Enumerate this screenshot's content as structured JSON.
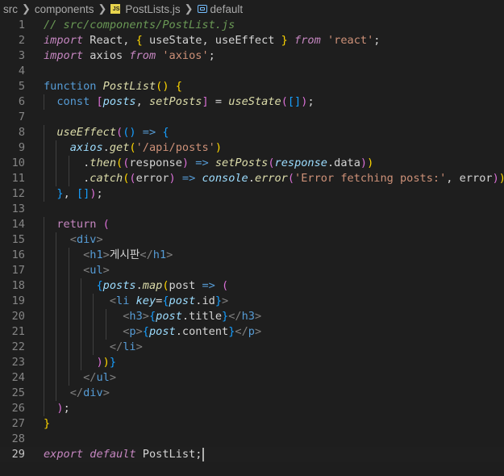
{
  "breadcrumb": {
    "folder1": "src",
    "folder2": "components",
    "file": "PostLists.js",
    "file_icon": "JS",
    "symbol": "default"
  },
  "editor": {
    "current_line": 29,
    "lines": [
      {
        "n": "1",
        "t": [
          {
            "c": "cm",
            "s": "// src/components/PostList.js"
          }
        ]
      },
      {
        "n": "2",
        "t": [
          {
            "c": "kw",
            "s": "import"
          },
          {
            "c": "tx",
            "s": " React, "
          },
          {
            "c": "br1",
            "s": "{"
          },
          {
            "c": "tx",
            "s": " useState, useEffect "
          },
          {
            "c": "br1",
            "s": "}"
          },
          {
            "c": "tx",
            "s": " "
          },
          {
            "c": "kw",
            "s": "from"
          },
          {
            "c": "tx",
            "s": " "
          },
          {
            "c": "st",
            "s": "'react'"
          },
          {
            "c": "tx",
            "s": ";"
          }
        ]
      },
      {
        "n": "3",
        "t": [
          {
            "c": "kw",
            "s": "import"
          },
          {
            "c": "tx",
            "s": " axios "
          },
          {
            "c": "kw",
            "s": "from"
          },
          {
            "c": "tx",
            "s": " "
          },
          {
            "c": "st",
            "s": "'axios'"
          },
          {
            "c": "tx",
            "s": ";"
          }
        ]
      },
      {
        "n": "4",
        "t": []
      },
      {
        "n": "5",
        "t": [
          {
            "c": "kwb",
            "s": "function"
          },
          {
            "c": "tx",
            "s": " "
          },
          {
            "c": "fn",
            "s": "PostList"
          },
          {
            "c": "br1",
            "s": "()"
          },
          {
            "c": "tx",
            "s": " "
          },
          {
            "c": "br1",
            "s": "{"
          }
        ]
      },
      {
        "n": "6",
        "t": [
          {
            "c": "tx",
            "s": "  "
          },
          {
            "c": "kwb",
            "s": "const"
          },
          {
            "c": "tx",
            "s": " "
          },
          {
            "c": "br2",
            "s": "["
          },
          {
            "c": "vr",
            "s": "posts"
          },
          {
            "c": "tx",
            "s": ", "
          },
          {
            "c": "fn",
            "s": "setPosts"
          },
          {
            "c": "br2",
            "s": "]"
          },
          {
            "c": "tx",
            "s": " = "
          },
          {
            "c": "fn",
            "s": "useState"
          },
          {
            "c": "br2",
            "s": "("
          },
          {
            "c": "br3",
            "s": "[]"
          },
          {
            "c": "br2",
            "s": ")"
          },
          {
            "c": "tx",
            "s": ";"
          }
        ]
      },
      {
        "n": "7",
        "t": []
      },
      {
        "n": "8",
        "t": [
          {
            "c": "tx",
            "s": "  "
          },
          {
            "c": "fn",
            "s": "useEffect"
          },
          {
            "c": "br2",
            "s": "("
          },
          {
            "c": "br3",
            "s": "()"
          },
          {
            "c": "tx",
            "s": " "
          },
          {
            "c": "kwb",
            "s": "=>"
          },
          {
            "c": "tx",
            "s": " "
          },
          {
            "c": "br3",
            "s": "{"
          }
        ]
      },
      {
        "n": "9",
        "t": [
          {
            "c": "tx",
            "s": "    "
          },
          {
            "c": "vr",
            "s": "axios"
          },
          {
            "c": "tx",
            "s": "."
          },
          {
            "c": "fn",
            "s": "get"
          },
          {
            "c": "br1",
            "s": "("
          },
          {
            "c": "st",
            "s": "'/api/posts'"
          },
          {
            "c": "br1",
            "s": ")"
          }
        ]
      },
      {
        "n": "10",
        "t": [
          {
            "c": "tx",
            "s": "      ."
          },
          {
            "c": "fn",
            "s": "then"
          },
          {
            "c": "br1",
            "s": "("
          },
          {
            "c": "br2",
            "s": "("
          },
          {
            "c": "tx",
            "s": "response"
          },
          {
            "c": "br2",
            "s": ")"
          },
          {
            "c": "tx",
            "s": " "
          },
          {
            "c": "kwb",
            "s": "=>"
          },
          {
            "c": "tx",
            "s": " "
          },
          {
            "c": "fn",
            "s": "setPosts"
          },
          {
            "c": "br2",
            "s": "("
          },
          {
            "c": "vr",
            "s": "response"
          },
          {
            "c": "tx",
            "s": ".data"
          },
          {
            "c": "br2",
            "s": ")"
          },
          {
            "c": "br1",
            "s": ")"
          }
        ]
      },
      {
        "n": "11",
        "t": [
          {
            "c": "tx",
            "s": "      ."
          },
          {
            "c": "fn",
            "s": "catch"
          },
          {
            "c": "br1",
            "s": "("
          },
          {
            "c": "br2",
            "s": "("
          },
          {
            "c": "tx",
            "s": "error"
          },
          {
            "c": "br2",
            "s": ")"
          },
          {
            "c": "tx",
            "s": " "
          },
          {
            "c": "kwb",
            "s": "=>"
          },
          {
            "c": "tx",
            "s": " "
          },
          {
            "c": "vr",
            "s": "console"
          },
          {
            "c": "tx",
            "s": "."
          },
          {
            "c": "fn",
            "s": "error"
          },
          {
            "c": "br2",
            "s": "("
          },
          {
            "c": "st",
            "s": "'Error fetching posts:'"
          },
          {
            "c": "tx",
            "s": ", error"
          },
          {
            "c": "br2",
            "s": ")"
          },
          {
            "c": "br1",
            "s": ")"
          },
          {
            "c": "tx",
            "s": ";"
          }
        ]
      },
      {
        "n": "12",
        "t": [
          {
            "c": "tx",
            "s": "  "
          },
          {
            "c": "br3",
            "s": "}"
          },
          {
            "c": "tx",
            "s": ", "
          },
          {
            "c": "br3",
            "s": "[]"
          },
          {
            "c": "br2",
            "s": ")"
          },
          {
            "c": "tx",
            "s": ";"
          }
        ]
      },
      {
        "n": "13",
        "t": []
      },
      {
        "n": "14",
        "t": [
          {
            "c": "tx",
            "s": "  "
          },
          {
            "c": "ctrl",
            "s": "return"
          },
          {
            "c": "tx",
            "s": " "
          },
          {
            "c": "br2",
            "s": "("
          }
        ]
      },
      {
        "n": "15",
        "t": [
          {
            "c": "tx",
            "s": "    "
          },
          {
            "c": "tg",
            "s": "<"
          },
          {
            "c": "tn",
            "s": "div"
          },
          {
            "c": "tg",
            "s": ">"
          }
        ]
      },
      {
        "n": "16",
        "t": [
          {
            "c": "tx",
            "s": "      "
          },
          {
            "c": "tg",
            "s": "<"
          },
          {
            "c": "tn",
            "s": "h1"
          },
          {
            "c": "tg",
            "s": ">"
          },
          {
            "c": "tx",
            "s": "게시판"
          },
          {
            "c": "tg",
            "s": "</"
          },
          {
            "c": "tn",
            "s": "h1"
          },
          {
            "c": "tg",
            "s": ">"
          }
        ]
      },
      {
        "n": "17",
        "t": [
          {
            "c": "tx",
            "s": "      "
          },
          {
            "c": "tg",
            "s": "<"
          },
          {
            "c": "tn",
            "s": "ul"
          },
          {
            "c": "tg",
            "s": ">"
          }
        ]
      },
      {
        "n": "18",
        "t": [
          {
            "c": "tx",
            "s": "        "
          },
          {
            "c": "br3",
            "s": "{"
          },
          {
            "c": "vr",
            "s": "posts"
          },
          {
            "c": "tx",
            "s": "."
          },
          {
            "c": "fn",
            "s": "map"
          },
          {
            "c": "br1",
            "s": "("
          },
          {
            "c": "tx",
            "s": "post "
          },
          {
            "c": "kwb",
            "s": "=>"
          },
          {
            "c": "tx",
            "s": " "
          },
          {
            "c": "br2",
            "s": "("
          }
        ]
      },
      {
        "n": "19",
        "t": [
          {
            "c": "tx",
            "s": "          "
          },
          {
            "c": "tg",
            "s": "<"
          },
          {
            "c": "tn",
            "s": "li"
          },
          {
            "c": "tx",
            "s": " "
          },
          {
            "c": "at",
            "s": "key"
          },
          {
            "c": "tx",
            "s": "="
          },
          {
            "c": "br3",
            "s": "{"
          },
          {
            "c": "vr",
            "s": "post"
          },
          {
            "c": "tx",
            "s": ".id"
          },
          {
            "c": "br3",
            "s": "}"
          },
          {
            "c": "tg",
            "s": ">"
          }
        ]
      },
      {
        "n": "20",
        "t": [
          {
            "c": "tx",
            "s": "            "
          },
          {
            "c": "tg",
            "s": "<"
          },
          {
            "c": "tn",
            "s": "h3"
          },
          {
            "c": "tg",
            "s": ">"
          },
          {
            "c": "br3",
            "s": "{"
          },
          {
            "c": "vr",
            "s": "post"
          },
          {
            "c": "tx",
            "s": ".title"
          },
          {
            "c": "br3",
            "s": "}"
          },
          {
            "c": "tg",
            "s": "</"
          },
          {
            "c": "tn",
            "s": "h3"
          },
          {
            "c": "tg",
            "s": ">"
          }
        ]
      },
      {
        "n": "21",
        "t": [
          {
            "c": "tx",
            "s": "            "
          },
          {
            "c": "tg",
            "s": "<"
          },
          {
            "c": "tn",
            "s": "p"
          },
          {
            "c": "tg",
            "s": ">"
          },
          {
            "c": "br3",
            "s": "{"
          },
          {
            "c": "vr",
            "s": "post"
          },
          {
            "c": "tx",
            "s": ".content"
          },
          {
            "c": "br3",
            "s": "}"
          },
          {
            "c": "tg",
            "s": "</"
          },
          {
            "c": "tn",
            "s": "p"
          },
          {
            "c": "tg",
            "s": ">"
          }
        ]
      },
      {
        "n": "22",
        "t": [
          {
            "c": "tx",
            "s": "          "
          },
          {
            "c": "tg",
            "s": "</"
          },
          {
            "c": "tn",
            "s": "li"
          },
          {
            "c": "tg",
            "s": ">"
          }
        ]
      },
      {
        "n": "23",
        "t": [
          {
            "c": "tx",
            "s": "        "
          },
          {
            "c": "br2",
            "s": ")"
          },
          {
            "c": "br1",
            "s": ")"
          },
          {
            "c": "br3",
            "s": "}"
          }
        ]
      },
      {
        "n": "24",
        "t": [
          {
            "c": "tx",
            "s": "      "
          },
          {
            "c": "tg",
            "s": "</"
          },
          {
            "c": "tn",
            "s": "ul"
          },
          {
            "c": "tg",
            "s": ">"
          }
        ]
      },
      {
        "n": "25",
        "t": [
          {
            "c": "tx",
            "s": "    "
          },
          {
            "c": "tg",
            "s": "</"
          },
          {
            "c": "tn",
            "s": "div"
          },
          {
            "c": "tg",
            "s": ">"
          }
        ]
      },
      {
        "n": "26",
        "t": [
          {
            "c": "tx",
            "s": "  "
          },
          {
            "c": "br2",
            "s": ")"
          },
          {
            "c": "tx",
            "s": ";"
          }
        ]
      },
      {
        "n": "27",
        "t": [
          {
            "c": "br1",
            "s": "}"
          }
        ]
      },
      {
        "n": "28",
        "t": []
      },
      {
        "n": "29",
        "t": [
          {
            "c": "kw",
            "s": "export"
          },
          {
            "c": "tx",
            "s": " "
          },
          {
            "c": "kw",
            "s": "default"
          },
          {
            "c": "tx",
            "s": " PostList;"
          }
        ]
      }
    ]
  }
}
